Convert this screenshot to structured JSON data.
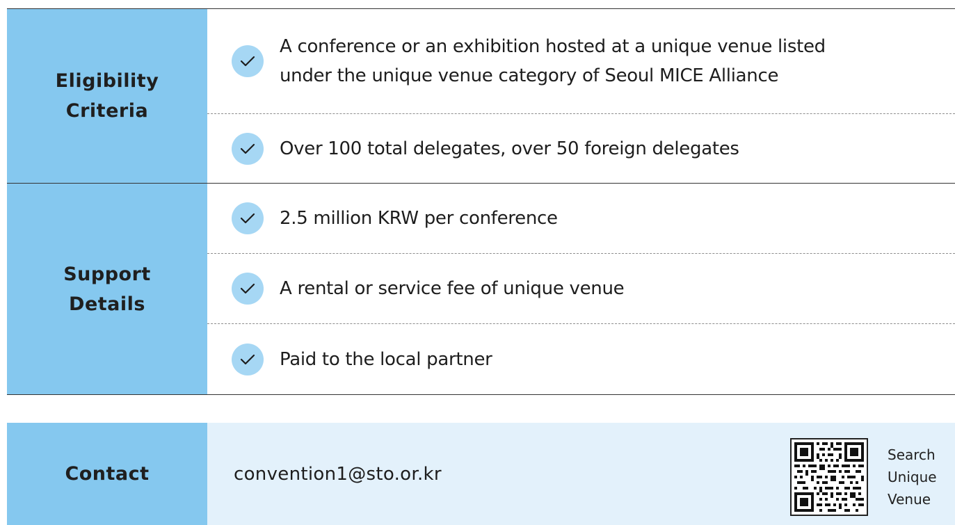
{
  "eligibility": {
    "heading_line1": "Eligibility",
    "heading_line2": "Criteria",
    "items": [
      {
        "line1": "A conference or an exhibition hosted at a unique venue listed",
        "line2": "under the unique venue category of Seoul MICE Alliance"
      },
      {
        "line1": "Over 100 total delegates, over 50 foreign delegates"
      }
    ]
  },
  "support": {
    "heading_line1": "Support",
    "heading_line2": "Details",
    "items": [
      {
        "line1": "2.5 million KRW per conference"
      },
      {
        "line1": "A rental or service fee of unique venue"
      },
      {
        "line1": "Paid to the local partner"
      }
    ]
  },
  "contact": {
    "heading": "Contact",
    "email": "convention1@sto.or.kr",
    "qr_label_line1": "Search",
    "qr_label_line2": "Unique",
    "qr_label_line3": "Venue"
  },
  "icons": {
    "check": "check-circle-icon",
    "qr": "qr-code-icon"
  },
  "colors": {
    "header_blue": "#85c8ef",
    "check_blue": "#a6d7f4",
    "contact_bg": "#e3f1fb"
  }
}
